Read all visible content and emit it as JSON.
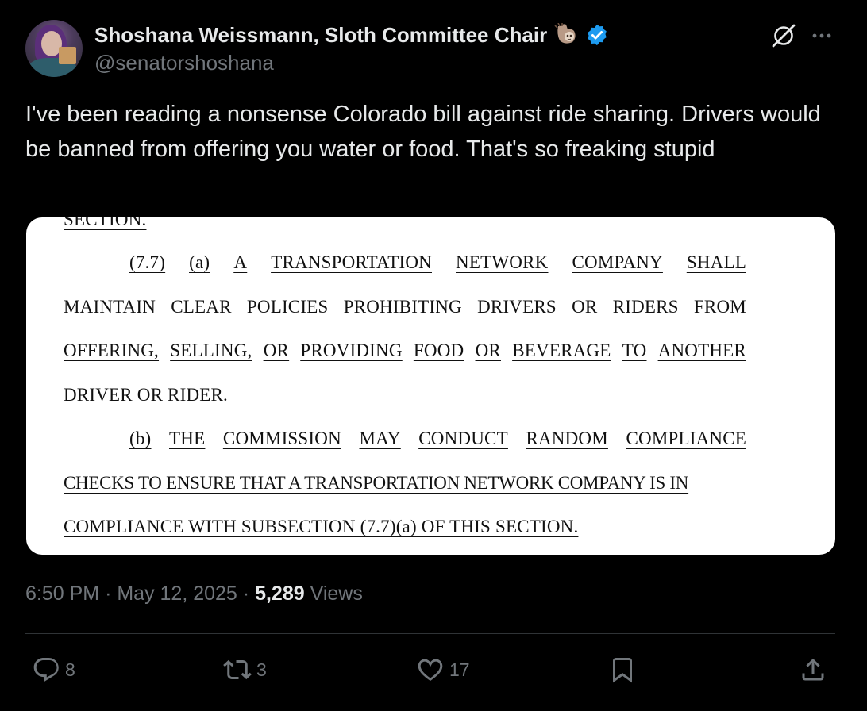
{
  "author": {
    "display_name": "Shoshana Weissmann, Sloth Committee Chair",
    "handle": "@senatorshoshana",
    "verified": true,
    "emoji": "sloth-icon",
    "verified_color": "#1d9bf0"
  },
  "tweet": {
    "text": "I've been reading a nonsense Colorado bill against ride sharing. Drivers would be banned from offering you water or food. That's so freaking stupid"
  },
  "document": {
    "line0": "SECTION.",
    "line1_words": [
      "(7.7)",
      "(a)",
      "A",
      "TRANSPORTATION",
      "NETWORK",
      "COMPANY",
      "SHALL"
    ],
    "line2_words": [
      "MAINTAIN",
      "CLEAR",
      "POLICIES",
      "PROHIBITING",
      "DRIVERS",
      "OR",
      "RIDERS",
      "FROM"
    ],
    "line3_words": [
      "OFFERING,",
      "SELLING,",
      "OR",
      "PROVIDING",
      "FOOD",
      "OR",
      "BEVERAGE",
      "TO",
      "ANOTHER"
    ],
    "line4": "DRIVER OR RIDER.",
    "line5_words": [
      "(b)",
      "THE",
      "COMMISSION",
      "MAY",
      "CONDUCT",
      "RANDOM",
      "COMPLIANCE"
    ],
    "line6": "CHECKS TO ENSURE THAT A TRANSPORTATION NETWORK COMPANY IS IN",
    "line7": "COMPLIANCE WITH SUBSECTION (7.7)(a) OF THIS SECTION."
  },
  "meta": {
    "time": "6:50 PM",
    "separator": "·",
    "date": "May 12, 2025",
    "views_count": "5,289",
    "views_label": "Views"
  },
  "actions": {
    "replies": "8",
    "reposts": "3",
    "likes": "17"
  },
  "colors": {
    "background": "#000000",
    "text_primary": "#e7e9ea",
    "text_secondary": "#71767b",
    "divider": "#2f3336"
  }
}
